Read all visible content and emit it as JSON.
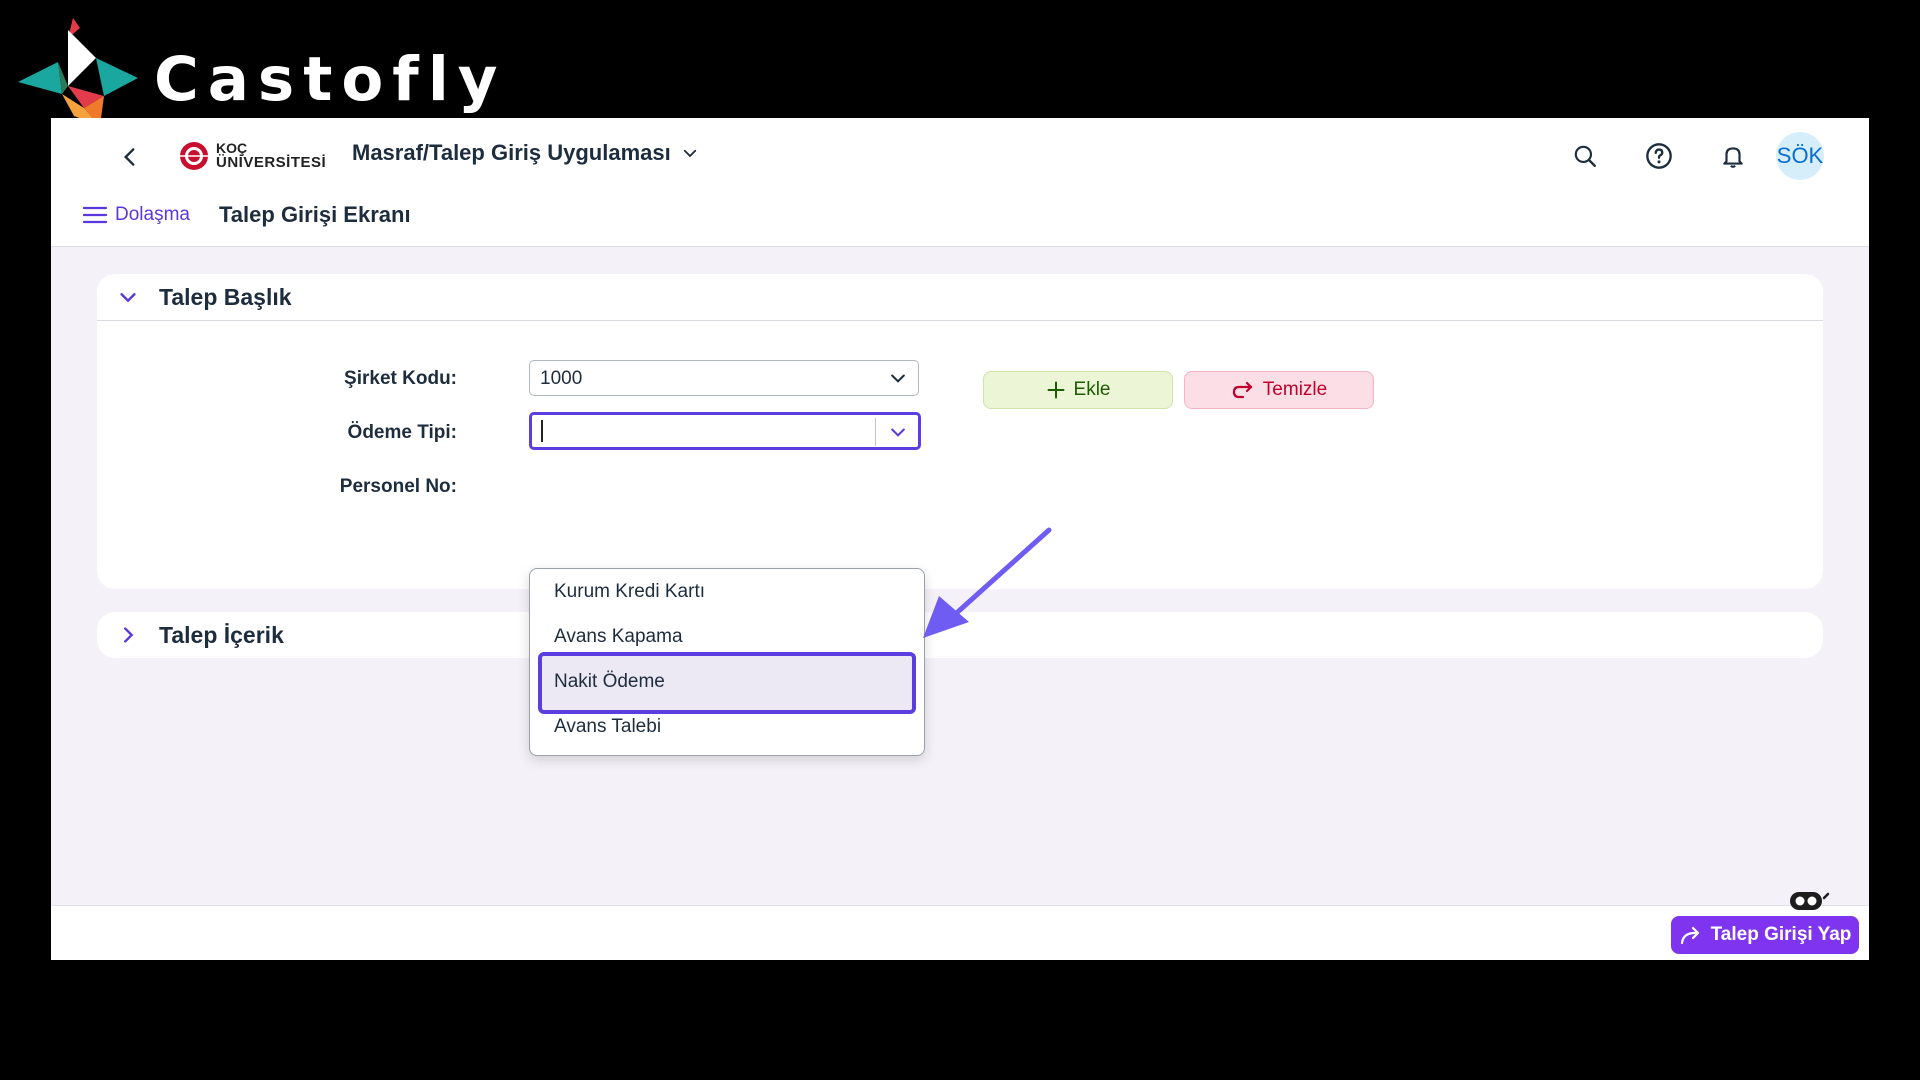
{
  "brand": {
    "name": "Castofly"
  },
  "shell": {
    "logo_line1": "KOÇ",
    "logo_line2": "ÜNİVERSİTESİ",
    "app_title": "Masraf/Talep Giriş Uygulaması",
    "avatar_initials": "SÖK"
  },
  "nav": {
    "menu_label": "Dolaşma",
    "page_title": "Talep Girişi Ekranı"
  },
  "header_panel": {
    "title": "Talep Başlık",
    "company_label": "Şirket Kodu:",
    "company_value": "1000",
    "payment_label": "Ödeme Tipi:",
    "payment_value": "",
    "personnel_label": "Personel No:",
    "add_label": "Ekle",
    "clear_label": "Temizle"
  },
  "dropdown": {
    "options": [
      "Kurum Kredi Kartı",
      "Avans Kapama",
      "Nakit Ödeme",
      "Avans Talebi"
    ],
    "highlighted": "Nakit Ödeme"
  },
  "content_panel": {
    "title": "Talep İçerik"
  },
  "footer": {
    "submit_label": "Talep Girişi Yap"
  },
  "colors": {
    "accent": "#5b3de0",
    "submit": "#7f35f0",
    "add_bg": "#ecf6d6",
    "clear_bg": "#fcdfe6"
  }
}
